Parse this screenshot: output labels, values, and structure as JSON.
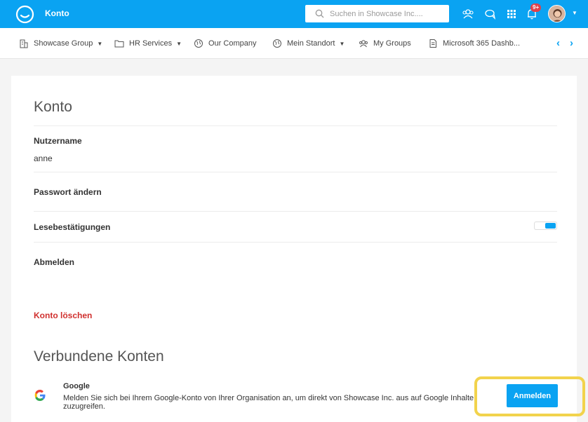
{
  "header": {
    "title": "Konto",
    "search_placeholder": "Suchen in Showcase Inc....",
    "notification_count": "9+",
    "icons": [
      "people-icon",
      "chat-icon",
      "apps-grid-icon",
      "bell-icon"
    ],
    "accent_color": "#0aa3f2"
  },
  "nav": {
    "items": [
      {
        "label": "Showcase Group",
        "icon": "building-icon",
        "dropdown": true
      },
      {
        "label": "HR Services",
        "icon": "folder-icon",
        "dropdown": true
      },
      {
        "label": "Our Company",
        "icon": "globe-icon",
        "dropdown": false
      },
      {
        "label": "Mein Standort",
        "icon": "globe-icon",
        "dropdown": true
      },
      {
        "label": "My Groups",
        "icon": "people-icon",
        "dropdown": false
      },
      {
        "label": "Microsoft 365 Dashb...",
        "icon": "document-icon",
        "dropdown": false
      }
    ]
  },
  "account": {
    "title": "Konto",
    "username_label": "Nutzername",
    "username_value": "anne",
    "change_password": "Passwort ändern",
    "read_receipts": "Lesebestätigungen",
    "read_receipts_enabled": true,
    "logout": "Abmelden",
    "delete_account": "Konto löschen"
  },
  "connected": {
    "title": "Verbundene Konten",
    "google_title": "Google",
    "google_desc": "Melden Sie sich bei Ihrem Google-Konto von Ihrer Organisation an, um direkt von Showcase Inc. aus auf Google Inhalte zuzugreifen.",
    "signin_label": "Anmelden"
  }
}
